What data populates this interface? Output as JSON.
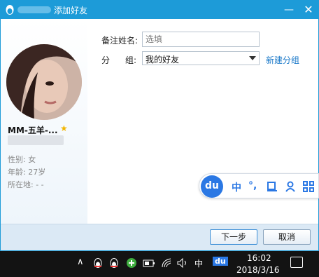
{
  "window": {
    "title": "添加好友"
  },
  "profile": {
    "name": "MM-五羊-...",
    "gender": "性别: 女",
    "age": "年龄: 27岁",
    "location": "所在地:  -     -"
  },
  "form": {
    "remark_label": "备注姓名:",
    "remark_placeholder": "选填",
    "group_label_1": "分",
    "group_label_2": "组:",
    "group_value": "我的好友",
    "new_group": "新建分组"
  },
  "buttons": {
    "next": "下一步",
    "cancel": "取消"
  },
  "ime": {
    "logo": "du",
    "chinese": "中",
    "punct": "°,",
    "icons": [
      "cup-icon",
      "user-icon",
      "grid-icon"
    ]
  },
  "taskbar": {
    "ime_label": "中",
    "ime_badge": "du",
    "time": "16:02",
    "date": "2018/3/16"
  },
  "colors": {
    "titlebar": "#1d9bd8",
    "link": "#1b79c9",
    "ime": "#2b78e4",
    "taskbar": "#131313"
  }
}
